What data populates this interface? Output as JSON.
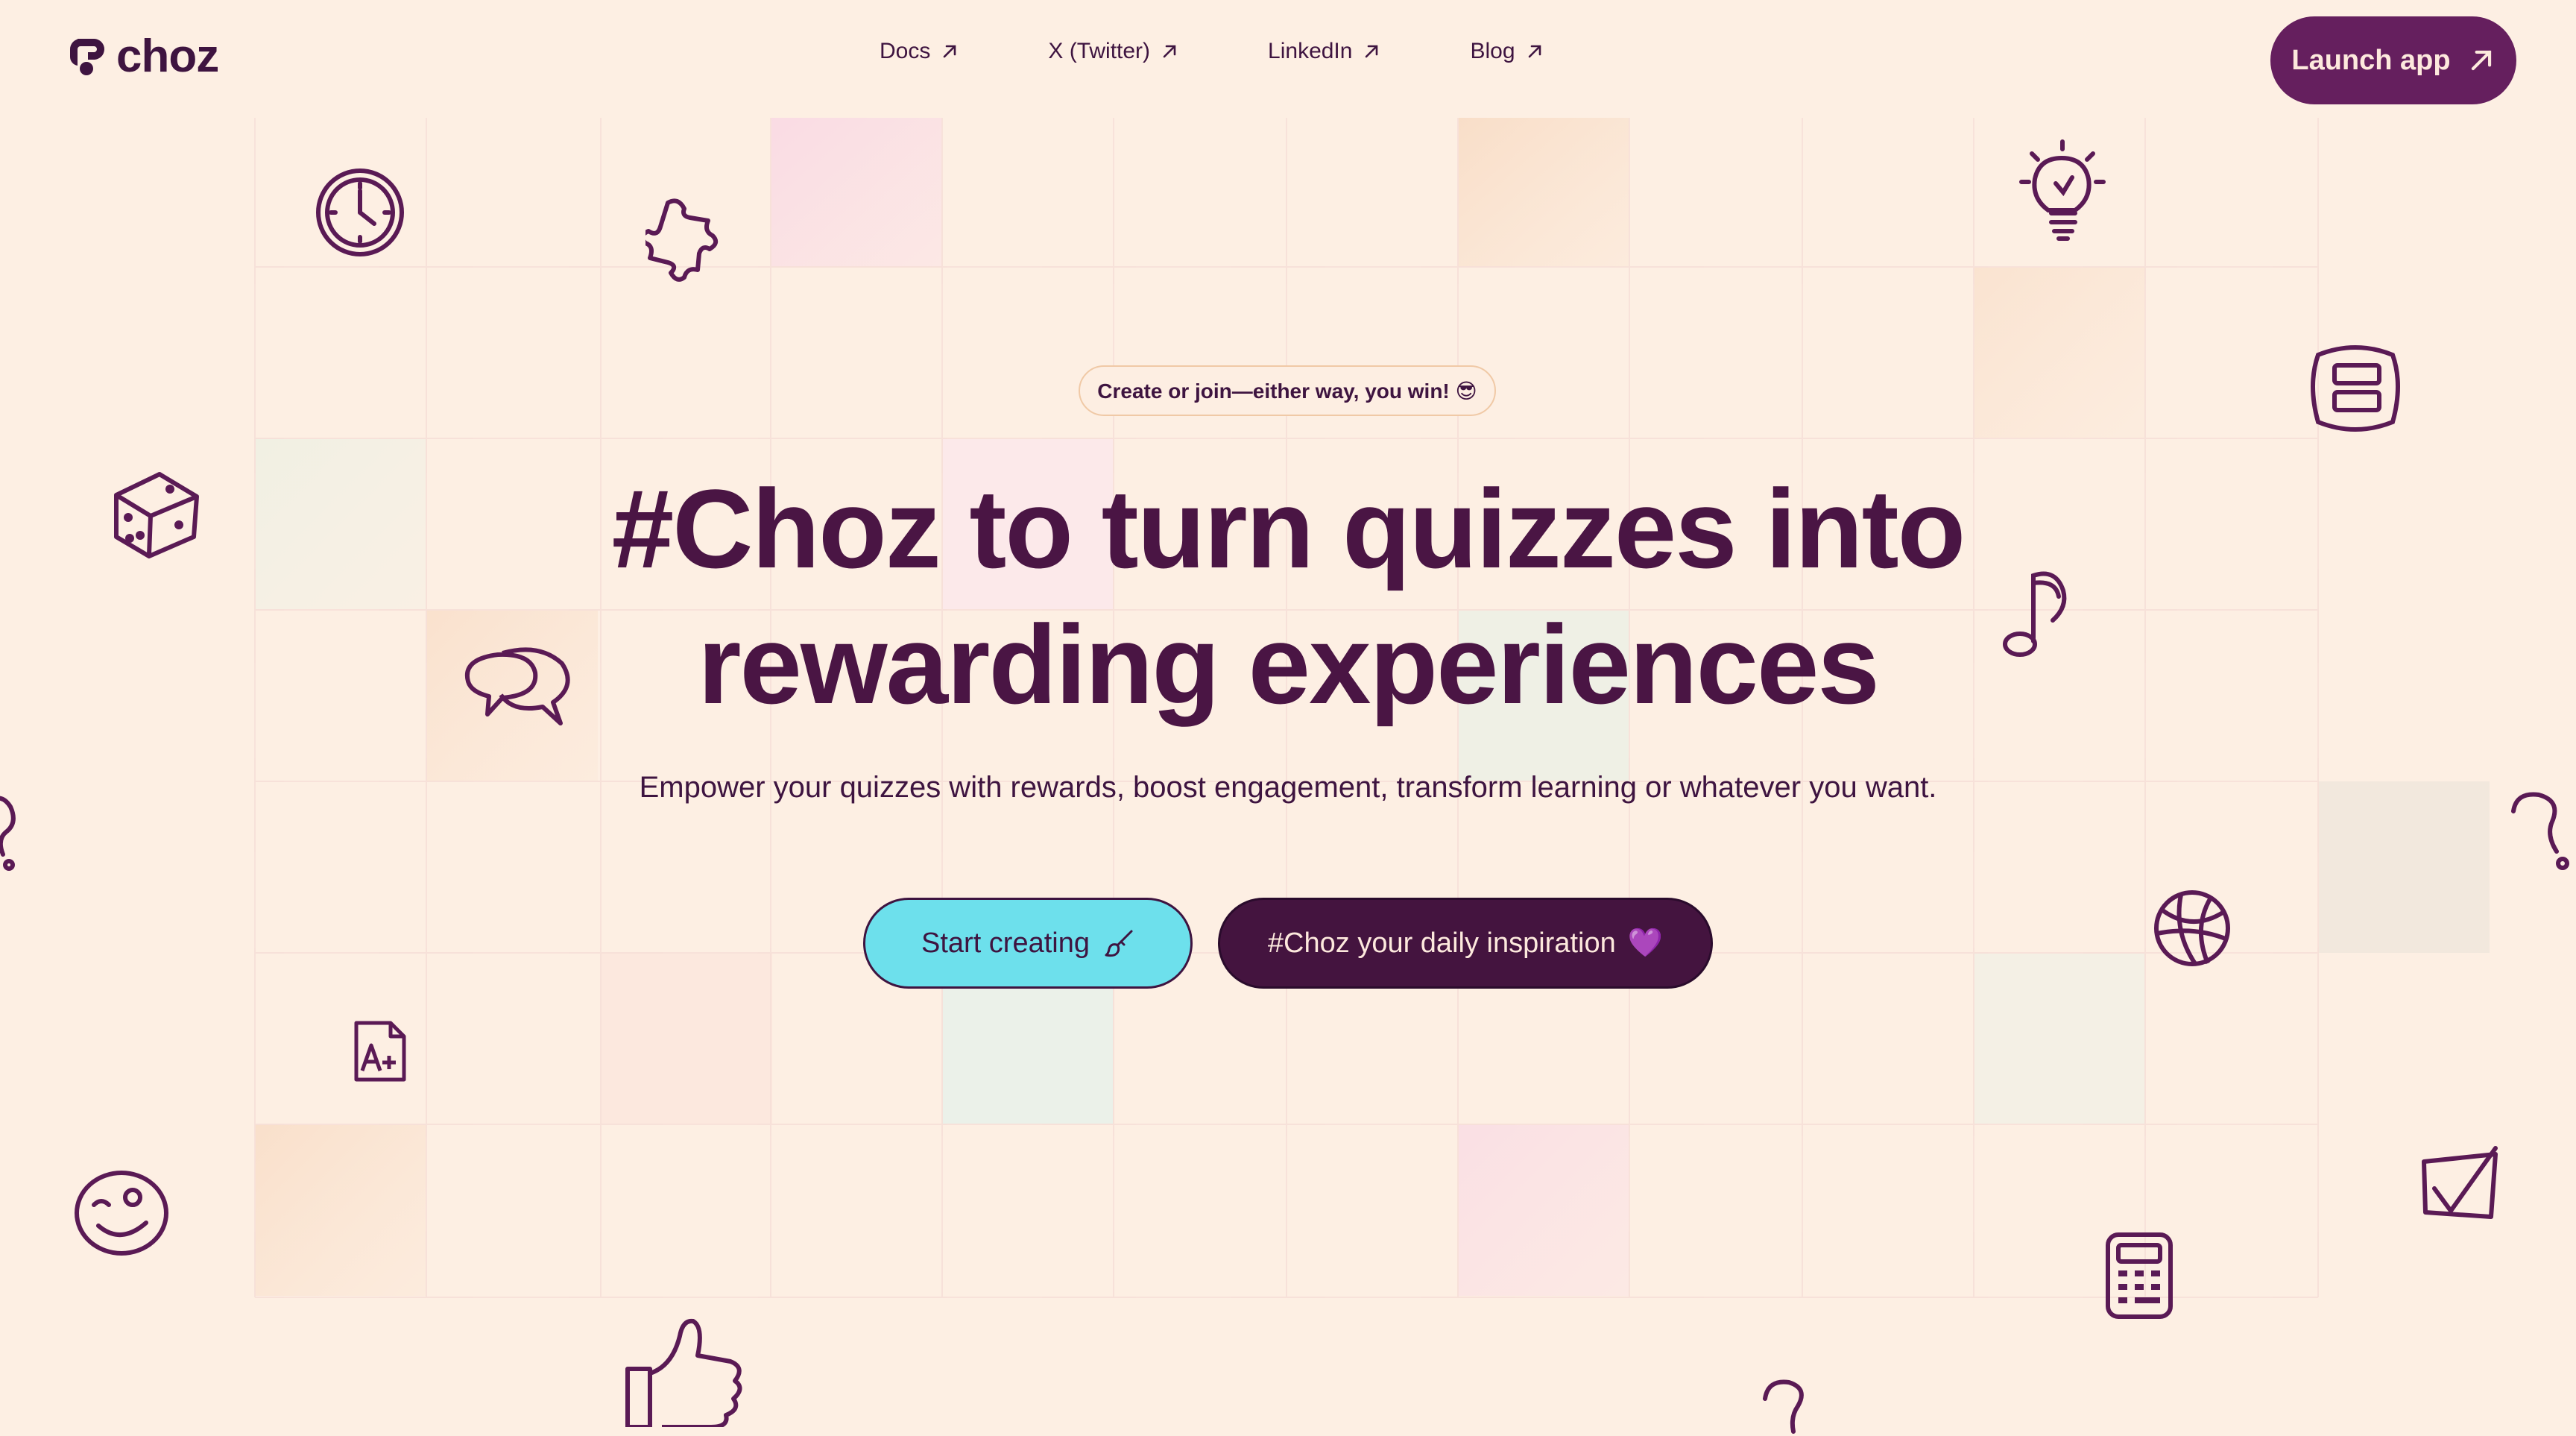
{
  "brand": {
    "name": "choz"
  },
  "nav": {
    "links": [
      {
        "label": "Docs",
        "icon": "arrow-up-right-icon"
      },
      {
        "label": "X (Twitter)",
        "icon": "arrow-up-right-icon"
      },
      {
        "label": "LinkedIn",
        "icon": "arrow-up-right-icon"
      },
      {
        "label": "Blog",
        "icon": "arrow-up-right-icon"
      }
    ],
    "launch_label": "Launch app"
  },
  "hero": {
    "badge": "Create or join—either way, you win! 😎",
    "headline_line1": "#Choz to turn quizzes into",
    "headline_line2": "rewarding experiences",
    "subtitle": "Empower your quizzes with rewards, boost engagement, transform learning or whatever you want.",
    "cta_primary": "Start creating",
    "cta_primary_icon": "paintbrush-icon",
    "cta_secondary": "#Choz your daily inspiration",
    "cta_secondary_emoji": "💜"
  },
  "colors": {
    "background": "#fdefe3",
    "primary": "#651f5e",
    "headline": "#4a1544",
    "accent_cyan": "#6de0ec",
    "dark": "#44143f"
  },
  "decorative_icons": [
    "clock-icon",
    "puzzle-icon",
    "lightbulb-icon",
    "dice-icon",
    "speech-bubbles-icon",
    "music-note-icon",
    "notebook-icon",
    "question-mark-icon",
    "basketball-icon",
    "grade-a-plus-icon",
    "smiley-icon",
    "checkbox-icon",
    "calculator-icon",
    "thumbs-up-icon"
  ]
}
